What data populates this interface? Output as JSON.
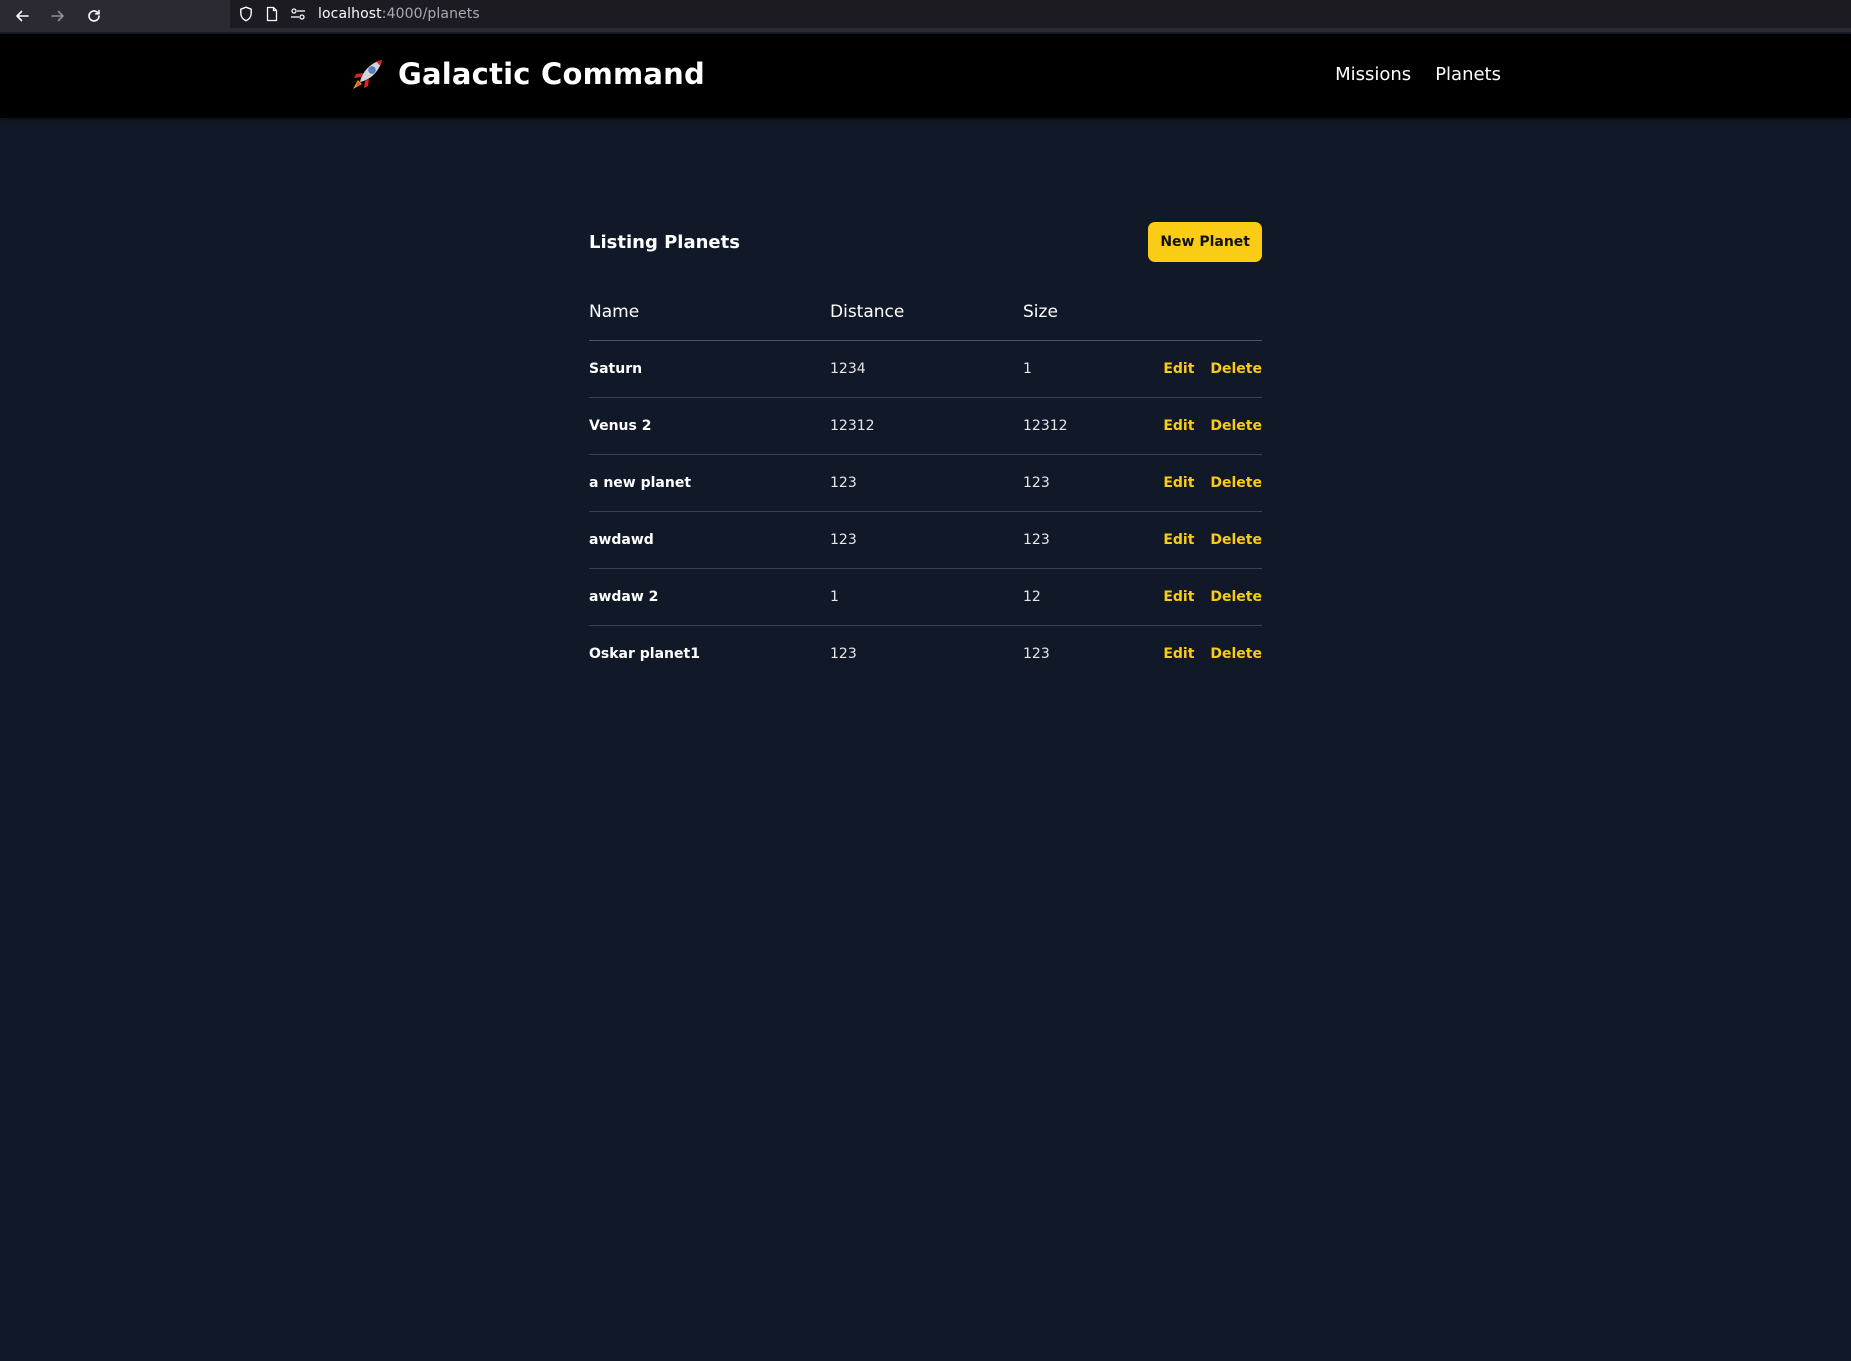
{
  "browser": {
    "url_host": "localhost",
    "url_path": ":4000/planets",
    "icons": [
      "back-arrow-icon",
      "forward-arrow-icon",
      "reload-icon",
      "shield-icon",
      "page-icon",
      "site-permissions-icon"
    ]
  },
  "header": {
    "brand_icon": "rocket-icon",
    "title": "Galactic Command",
    "nav": [
      {
        "label": "Missions"
      },
      {
        "label": "Planets"
      }
    ]
  },
  "main": {
    "title": "Listing Planets",
    "new_button_label": "New Planet",
    "columns": {
      "name": "Name",
      "distance": "Distance",
      "size": "Size"
    },
    "rows": [
      {
        "name": "Saturn",
        "distance": "1234",
        "size": "1",
        "edit": "Edit",
        "delete": "Delete"
      },
      {
        "name": "Venus 2",
        "distance": "12312",
        "size": "12312",
        "edit": "Edit",
        "delete": "Delete"
      },
      {
        "name": "a new planet",
        "distance": "123",
        "size": "123",
        "edit": "Edit",
        "delete": "Delete"
      },
      {
        "name": "awdawd",
        "distance": "123",
        "size": "123",
        "edit": "Edit",
        "delete": "Delete"
      },
      {
        "name": "awdaw 2",
        "distance": "1",
        "size": "12",
        "edit": "Edit",
        "delete": "Delete"
      },
      {
        "name": "Oskar planet1",
        "distance": "123",
        "size": "123",
        "edit": "Edit",
        "delete": "Delete"
      }
    ]
  },
  "colors": {
    "background": "#111827",
    "header_bg": "#000000",
    "accent": "#facc15",
    "divider": "#374151"
  }
}
